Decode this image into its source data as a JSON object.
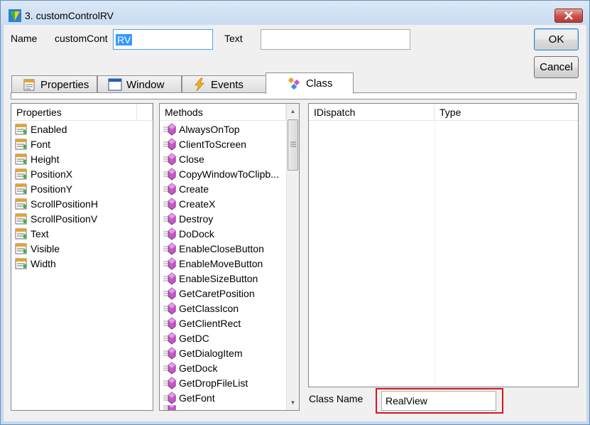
{
  "window": {
    "title": "3. customControlRV"
  },
  "form": {
    "name_label": "Name",
    "name_prefix": "customCont",
    "name_selected": "RV",
    "text_label": "Text",
    "text_value": "",
    "ok_label": "OK",
    "cancel_label": "Cancel"
  },
  "tabs": [
    {
      "label": "Properties",
      "icon": "properties-icon"
    },
    {
      "label": "Window",
      "icon": "window-icon"
    },
    {
      "label": "Events",
      "icon": "lightning-icon"
    },
    {
      "label": "Class",
      "icon": "class-icon",
      "active": true
    }
  ],
  "properties": {
    "header": "Properties",
    "items": [
      "Enabled",
      "Font",
      "Height",
      "PositionX",
      "PositionY",
      "ScrollPositionH",
      "ScrollPositionV",
      "Text",
      "Visible",
      "Width"
    ]
  },
  "methods": {
    "header": "Methods",
    "items": [
      "AlwaysOnTop",
      "ClientToScreen",
      "Close",
      "CopyWindowToClipb...",
      "Create",
      "CreateX",
      "Destroy",
      "DoDock",
      "EnableCloseButton",
      "EnableMoveButton",
      "EnableSizeButton",
      "GetCaretPosition",
      "GetClassIcon",
      "GetClientRect",
      "GetDC",
      "GetDialogItem",
      "GetDock",
      "GetDropFileList",
      "GetFont"
    ]
  },
  "idispatch": {
    "col1": "IDispatch",
    "col2": "Type"
  },
  "class_name": {
    "label": "Class Name",
    "value": "RealView",
    "highlight_color": "#d9161e"
  },
  "colors": {
    "selection": "#3399ff",
    "method_icon": "#c658c9"
  }
}
